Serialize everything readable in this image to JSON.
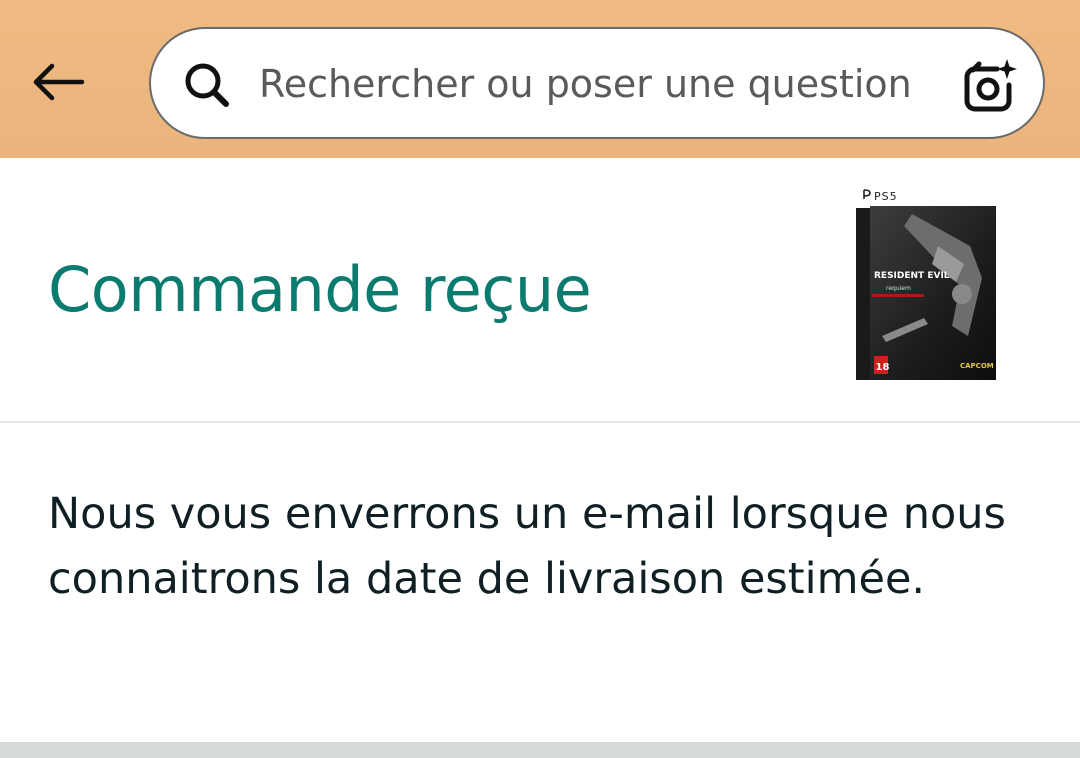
{
  "header": {
    "back_icon": "arrow-left-icon",
    "search": {
      "placeholder": "Rechercher ou poser une question",
      "value": "",
      "search_icon": "search-icon",
      "camera_icon": "camera-sparkle-icon"
    },
    "bg_color": "#eab47c"
  },
  "order_status": {
    "title": "Commande reçue",
    "title_color": "#0b7b6f",
    "product_image": {
      "platform_label": "PS5",
      "game_title": "RESIDENT EVIL",
      "game_subtitle": "requiem",
      "age_rating": "18",
      "publisher": "CAPCOM"
    }
  },
  "message": {
    "text": "Nous vous enverrons un e-mail lorsque nous connaitrons la date de livraison estimée."
  }
}
